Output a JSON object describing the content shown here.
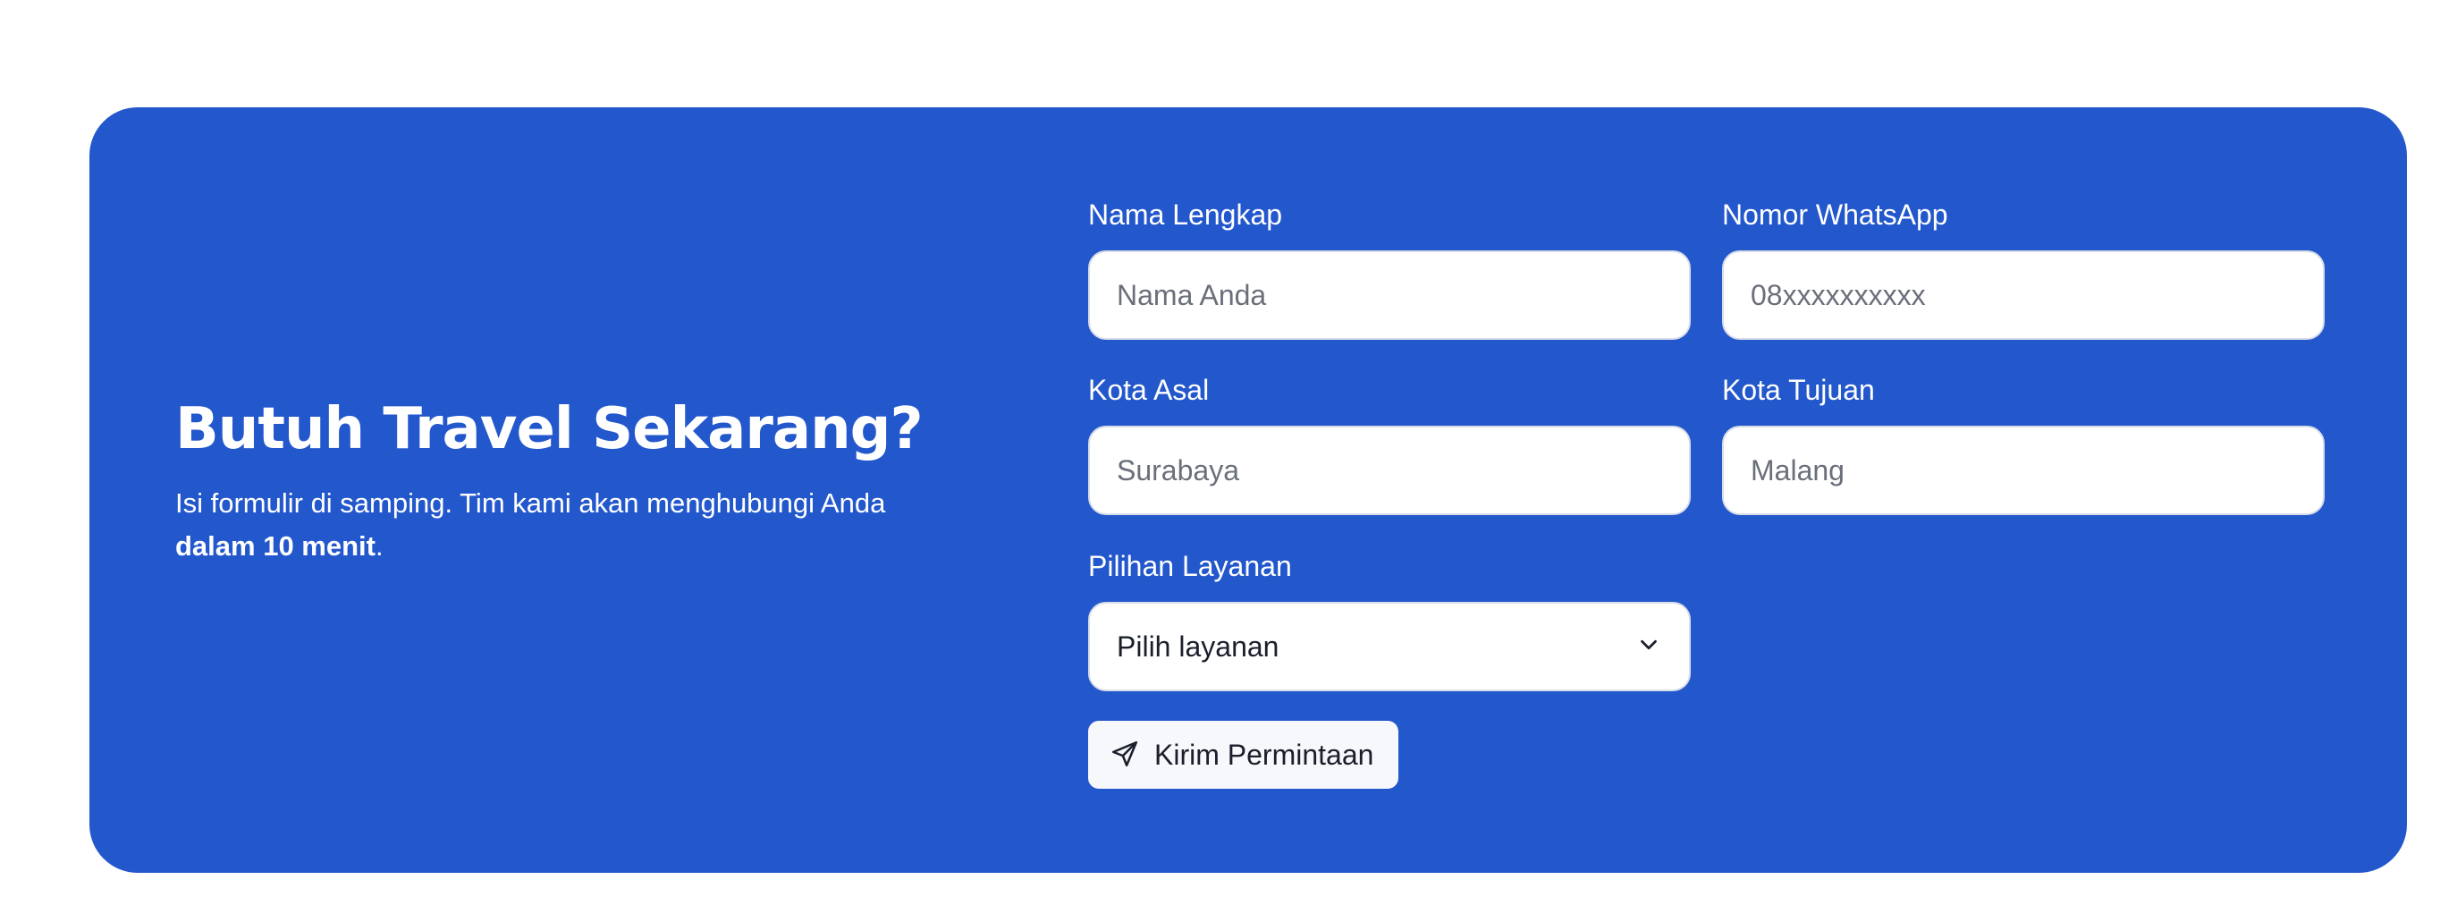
{
  "cta": {
    "title": "Butuh Travel Sekarang?",
    "desc_prefix": "Isi formulir di samping. Tim kami akan menghubungi Anda",
    "desc_bold": "dalam 10 menit",
    "desc_suffix": "."
  },
  "form": {
    "name": {
      "label": "Nama Lengkap",
      "placeholder": "Nama Anda",
      "value": ""
    },
    "whatsapp": {
      "label": "Nomor WhatsApp",
      "placeholder": "08xxxxxxxxxx",
      "value": ""
    },
    "origin": {
      "label": "Kota Asal",
      "placeholder": "Surabaya",
      "value": ""
    },
    "destination": {
      "label": "Kota Tujuan",
      "placeholder": "Malang",
      "value": ""
    },
    "service": {
      "label": "Pilihan Layanan",
      "selected": "Pilih layanan",
      "icon": "chevron-down-icon"
    },
    "submit": {
      "label": "Kirim Permintaan",
      "icon": "send-icon"
    }
  },
  "colors": {
    "panel_bg": "#2357cc",
    "text_on_panel": "#ffffff",
    "input_bg": "#ffffff",
    "button_bg": "#f7f8fb"
  }
}
